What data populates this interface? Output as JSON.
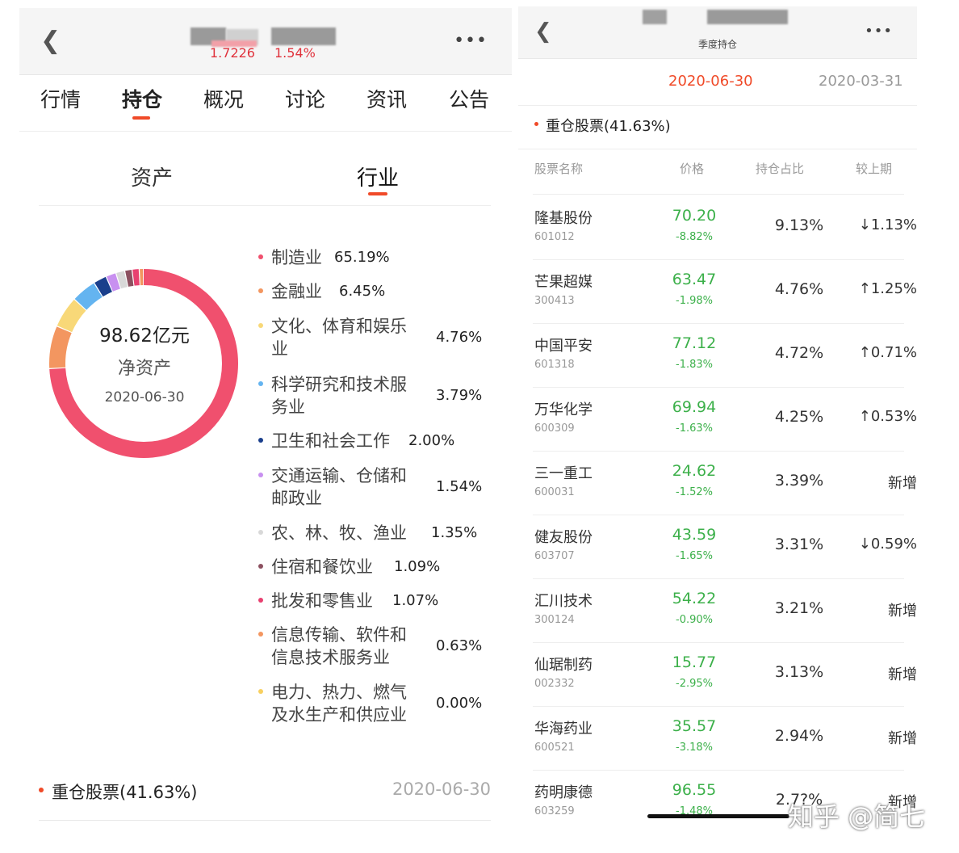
{
  "left": {
    "header": {
      "price": "1.7226",
      "change": "1.54%"
    },
    "tabs": [
      "行情",
      "持仓",
      "概况",
      "讨论",
      "资讯",
      "公告"
    ],
    "active_tab": "持仓",
    "subtabs": [
      "资产",
      "行业"
    ],
    "active_subtab": "行业",
    "donut": {
      "amount": "98.62亿元",
      "label": "净资产",
      "date": "2020-06-30"
    },
    "industries": [
      {
        "name": "制造业",
        "pct": "65.19%",
        "value": 65.19,
        "color": "#f0506e"
      },
      {
        "name": "金融业",
        "pct": "6.45%",
        "value": 6.45,
        "color": "#f39660"
      },
      {
        "name": "文化、体育和娱乐业",
        "lines": [
          "文化、体育和娱乐",
          "业"
        ],
        "pct": "4.76%",
        "value": 4.76,
        "color": "#f8d878"
      },
      {
        "name": "科学研究和技术服务业",
        "lines": [
          "科学研究和技术服",
          "务业"
        ],
        "pct": "3.79%",
        "value": 3.79,
        "color": "#64b4f0"
      },
      {
        "name": "卫生和社会工作",
        "pct": "2.00%",
        "value": 2.0,
        "color": "#1a3f8c"
      },
      {
        "name": "交通运输、仓储和邮政业",
        "lines": [
          "交通运输、仓储和",
          "邮政业"
        ],
        "pct": "1.54%",
        "value": 1.54,
        "color": "#c890f0"
      },
      {
        "name": "农、林、牧、渔业",
        "pct": "1.35%",
        "value": 1.35,
        "color": "#d8d8d8"
      },
      {
        "name": "住宿和餐饮业",
        "pct": "1.09%",
        "value": 1.09,
        "color": "#8c5060"
      },
      {
        "name": "批发和零售业",
        "pct": "1.07%",
        "value": 1.07,
        "color": "#e84070"
      },
      {
        "name": "信息传输、软件和信息技术服务业",
        "lines": [
          "信息传输、软件和",
          "信息技术服务业"
        ],
        "pct": "0.63%",
        "value": 0.63,
        "color": "#f39660"
      },
      {
        "name": "电力、热力、燃气及水生产和供应业",
        "lines": [
          "电力、热力、燃气",
          "及水生产和供应业"
        ],
        "pct": "0.00%",
        "value": 0.0,
        "color": "#f8d060"
      }
    ],
    "bottom": {
      "title": "重仓股票(41.63%)",
      "date": "2020-06-30"
    }
  },
  "right": {
    "header": {
      "subtitle": "季度持仓"
    },
    "dates": [
      "2020-06-30",
      "2020-03-31"
    ],
    "active_date": "2020-06-30",
    "section_title": "重仓股票(41.63%)",
    "columns": [
      "股票名称",
      "价格",
      "持仓占比",
      "较上期"
    ],
    "stocks": [
      {
        "name": "隆基股份",
        "code": "601012",
        "price": "70.20",
        "change": "-8.82%",
        "share": "9.13%",
        "vs": "↓1.13%"
      },
      {
        "name": "芒果超媒",
        "code": "300413",
        "price": "63.47",
        "change": "-1.98%",
        "share": "4.76%",
        "vs": "↑1.25%"
      },
      {
        "name": "中国平安",
        "code": "601318",
        "price": "77.12",
        "change": "-1.83%",
        "share": "4.72%",
        "vs": "↑0.71%"
      },
      {
        "name": "万华化学",
        "code": "600309",
        "price": "69.94",
        "change": "-1.63%",
        "share": "4.25%",
        "vs": "↑0.53%"
      },
      {
        "name": "三一重工",
        "code": "600031",
        "price": "24.62",
        "change": "-1.52%",
        "share": "3.39%",
        "vs": "新增"
      },
      {
        "name": "健友股份",
        "code": "603707",
        "price": "43.59",
        "change": "-1.65%",
        "share": "3.31%",
        "vs": "↓0.59%"
      },
      {
        "name": "汇川技术",
        "code": "300124",
        "price": "54.22",
        "change": "-0.90%",
        "share": "3.21%",
        "vs": "新增"
      },
      {
        "name": "仙琚制药",
        "code": "002332",
        "price": "15.77",
        "change": "-2.95%",
        "share": "3.13%",
        "vs": "新增"
      },
      {
        "name": "华海药业",
        "code": "600521",
        "price": "35.57",
        "change": "-3.18%",
        "share": "2.94%",
        "vs": "新增"
      },
      {
        "name": "药明康德",
        "code": "603259",
        "price": "96.55",
        "change": "-1.48%",
        "share": "2.7?%",
        "vs": "新增"
      }
    ],
    "watermark": "知乎 @简七"
  }
}
